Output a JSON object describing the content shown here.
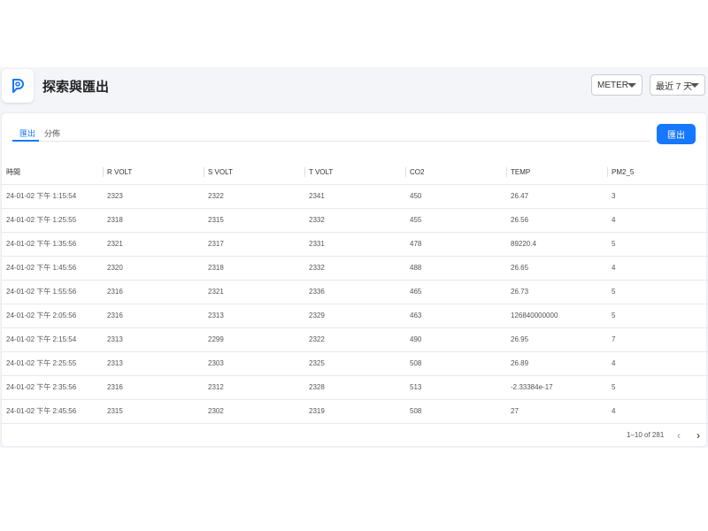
{
  "header": {
    "title": "探索與匯出",
    "meter_select": "METER",
    "range_select": "最近 7 天"
  },
  "tabs": [
    {
      "label": "匯出"
    },
    {
      "label": "分佈"
    }
  ],
  "export_button": "匯出",
  "table": {
    "columns": [
      "時間",
      "R VOLT",
      "S VOLT",
      "T VOLT",
      "CO2",
      "TEMP",
      "PM2_5"
    ],
    "rows": [
      [
        "24-01-02 下午 1:15:54",
        "2323",
        "2322",
        "2341",
        "450",
        "26.47",
        "3"
      ],
      [
        "24-01-02 下午 1:25:55",
        "2318",
        "2315",
        "2332",
        "455",
        "26.56",
        "4"
      ],
      [
        "24-01-02 下午 1:35:56",
        "2321",
        "2317",
        "2331",
        "478",
        "89220.4",
        "5"
      ],
      [
        "24-01-02 下午 1:45:56",
        "2320",
        "2318",
        "2332",
        "488",
        "26.65",
        "4"
      ],
      [
        "24-01-02 下午 1:55:56",
        "2316",
        "2321",
        "2336",
        "465",
        "26.73",
        "5"
      ],
      [
        "24-01-02 下午 2:05:56",
        "2316",
        "2313",
        "2329",
        "463",
        "126840000000",
        "5"
      ],
      [
        "24-01-02 下午 2:15:54",
        "2313",
        "2299",
        "2322",
        "490",
        "26.95",
        "7"
      ],
      [
        "24-01-02 下午 2:25:55",
        "2313",
        "2303",
        "2325",
        "508",
        "26.89",
        "4"
      ],
      [
        "24-01-02 下午 2:35:56",
        "2316",
        "2312",
        "2328",
        "513",
        "-2.33384e-17",
        "5"
      ],
      [
        "24-01-02 下午 2:45:56",
        "2315",
        "2302",
        "2319",
        "508",
        "27",
        "4"
      ]
    ]
  },
  "pagination": {
    "range_text": "1–10 of 281",
    "prev_icon": "chevron-left-icon",
    "next_icon": "chevron-right-icon"
  },
  "colors": {
    "accent": "#1677ff",
    "background": "#f3f5f9"
  }
}
